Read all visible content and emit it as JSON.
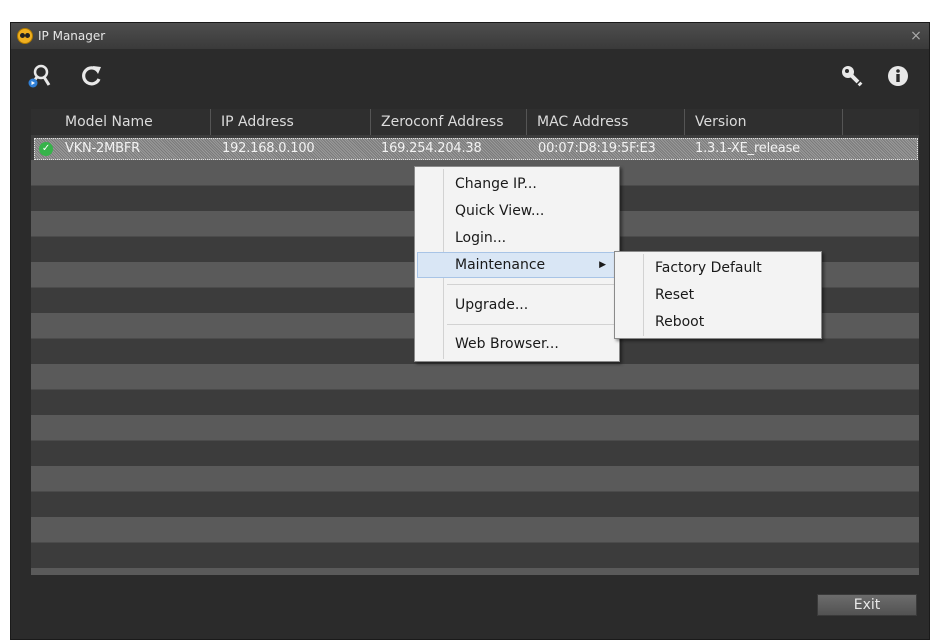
{
  "window": {
    "title": "IP Manager",
    "close_glyph": "×"
  },
  "toolbar": {
    "left_icons": [
      "search-device-icon",
      "refresh-icon"
    ],
    "right_icons": [
      "key-icon",
      "info-icon"
    ]
  },
  "table": {
    "columns": [
      "Model Name",
      "IP Address",
      "Zeroconf Address",
      "MAC Address",
      "Version"
    ],
    "rows": [
      {
        "model": "VKN-2MBFR",
        "ip": "192.168.0.100",
        "zeroconf": "169.254.204.38",
        "mac": "00:07:D8:19:5F:E3",
        "version": "1.3.1-XE_release",
        "status_icon": "check-icon"
      }
    ]
  },
  "context_menu": {
    "items": [
      "Change IP...",
      "Quick View...",
      "Login...",
      "Maintenance",
      "Upgrade...",
      "Web Browser..."
    ],
    "submenu_arrow": "▶"
  },
  "submenu": {
    "items": [
      "Factory Default",
      "Reset",
      "Reboot"
    ]
  },
  "footer": {
    "exit_label": "Exit"
  },
  "colors": {
    "window_bg": "#2b2b2b",
    "row_light": "#5a5a5a",
    "row_dark": "#3c3c3c",
    "menu_bg": "#f3f3f3",
    "menu_highlight": "#d9e6f5",
    "status_ok": "#36b34a"
  }
}
